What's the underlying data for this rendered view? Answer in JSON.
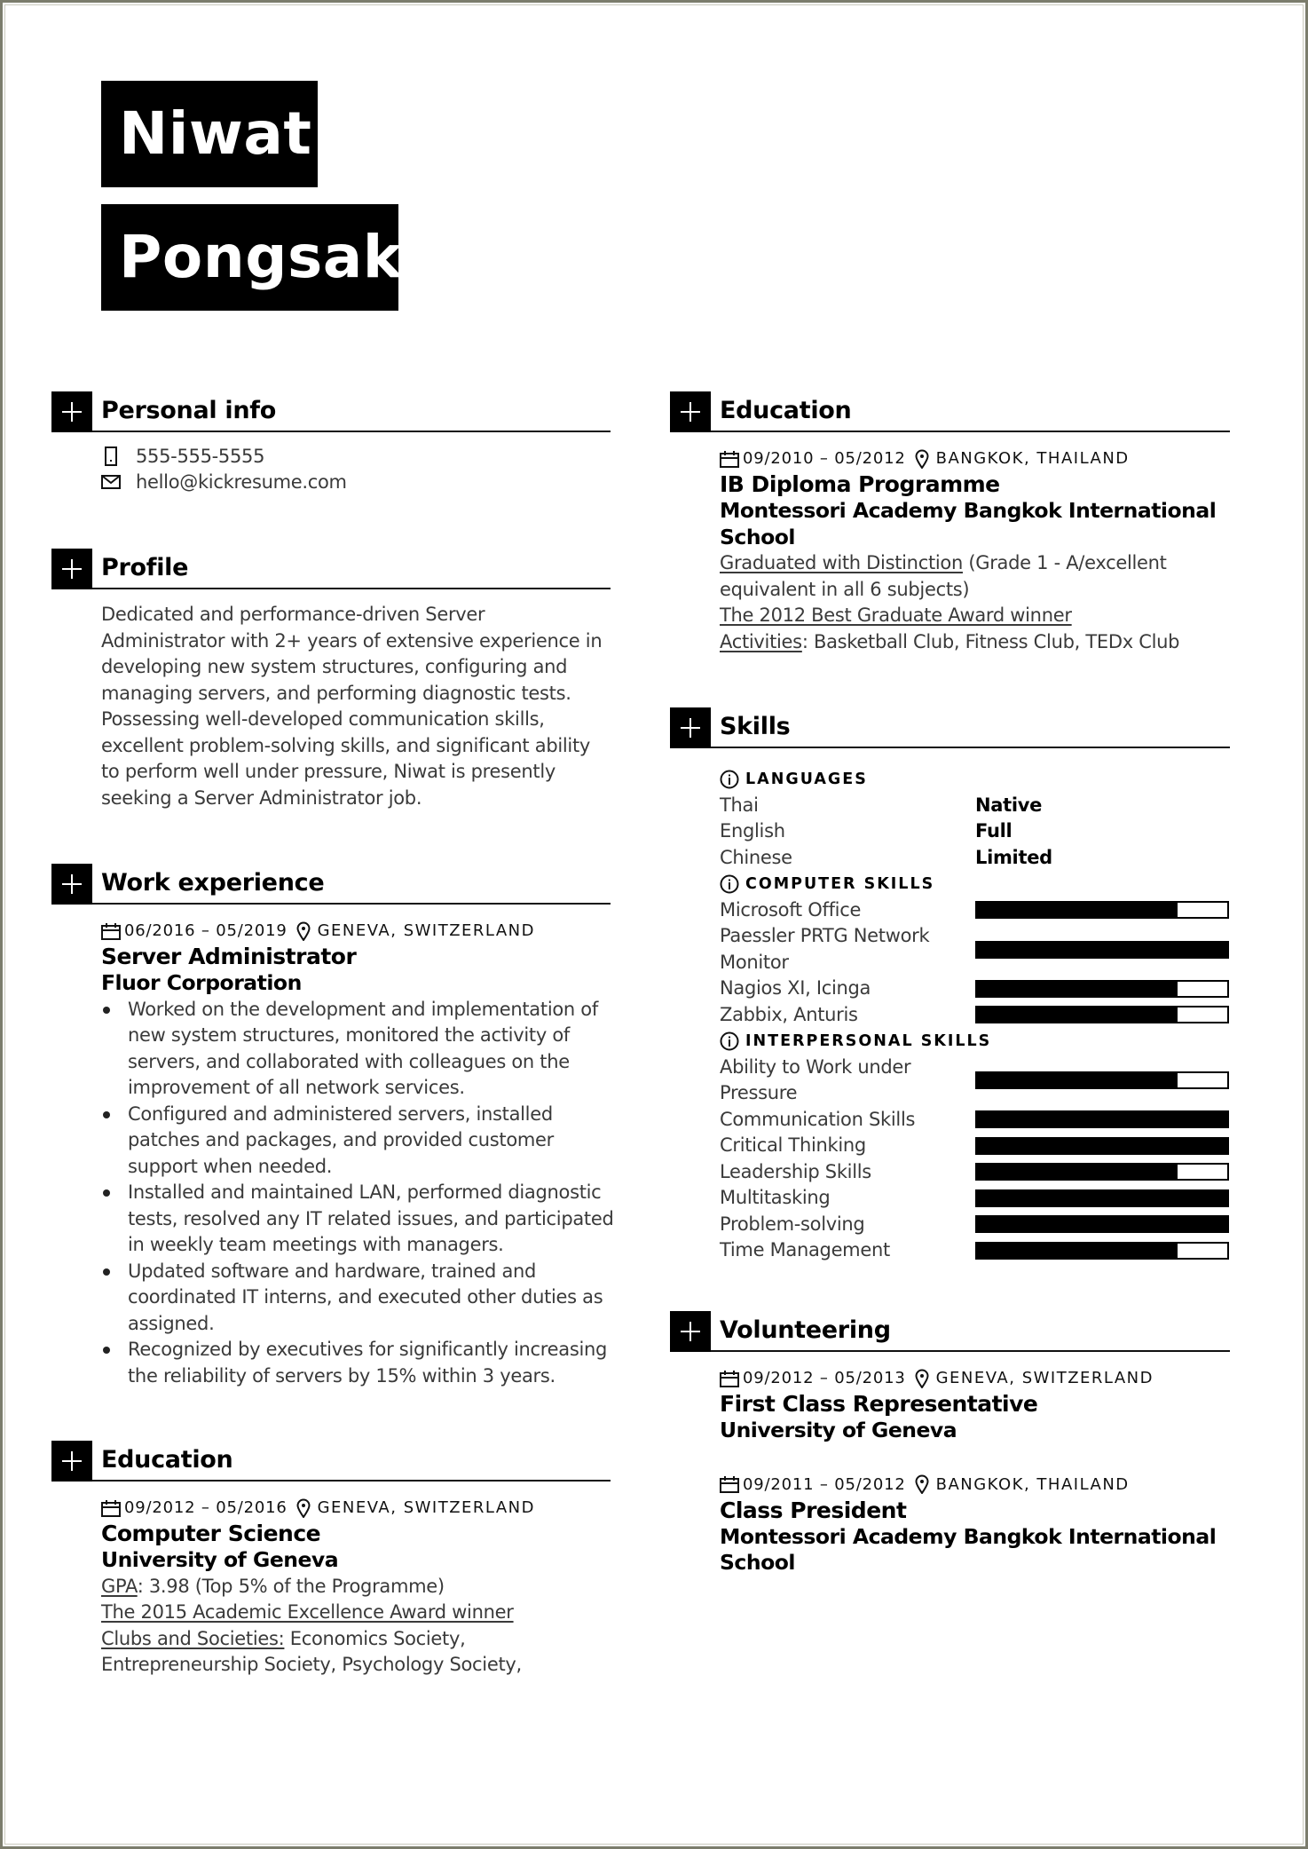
{
  "name": {
    "first": "Niwat",
    "last": "Pongsak"
  },
  "personal_info": {
    "title": "Personal info",
    "phone": "555-555-5555",
    "email": "hello@kickresume.com"
  },
  "profile": {
    "title": "Profile",
    "lines": [
      "Dedicated and performance-driven Server",
      "Administrator with 2+ years of extensive experience in",
      "developing new system structures, configuring and",
      "managing servers, and performing diagnostic tests.",
      "Possessing well-developed communication skills,",
      "excellent problem-solving skills, and significant ability",
      "to perform well under pressure, Niwat is presently",
      "seeking a Server Administrator job."
    ]
  },
  "work_experience": {
    "title": "Work experience",
    "entries": [
      {
        "dates": "06/2016 – 05/2019",
        "location": "GENEVA, SWITZERLAND",
        "role": "Server Administrator",
        "company": "Fluor Corporation",
        "bullets": [
          "Worked on the development and implementation of new system structures, monitored the activity of servers, and collaborated with colleagues on the improvement of all network services.",
          "Configured and administered servers, installed patches and packages, and provided customer support when needed.",
          "Installed and maintained LAN, performed diagnostic tests, resolved any IT related issues, and participated in weekly team meetings with managers.",
          "Updated software and hardware, trained and coordinated IT interns, and executed other duties as assigned.",
          "Recognized by executives for significantly increasing the reliability of servers by 15% within 3 years."
        ]
      }
    ]
  },
  "education_left": {
    "title": "Education",
    "dates": "09/2012 – 05/2016",
    "location": "GENEVA, SWITZERLAND",
    "degree": "Computer Science",
    "school": "University of Geneva",
    "gpa_label": "GPA",
    "gpa_value": ": 3.98 (Top 5% of the Programme)",
    "award": "The 2015 Academic Excellence Award winner",
    "clubs_label": "Clubs and Societies:",
    "clubs_value": " Economics Society,",
    "clubs_line2": "Entrepreneurship Society, Psychology Society,"
  },
  "education_right": {
    "title": "Education",
    "dates": "09/2010 – 05/2012",
    "location": "BANGKOK, THAILAND",
    "degree": "IB Diploma Programme",
    "school_line1": "Montessori Academy Bangkok International",
    "school_line2": "School",
    "distinction_label": "Graduated with Distinction",
    "distinction_value": " (Grade 1 - A/excellent",
    "distinction_line2": "equivalent in all 6 subjects)",
    "award": "The 2012 Best Graduate Award winner",
    "activities_label": "Activities",
    "activities_value": ": Basketball Club, Fitness Club, TEDx Club"
  },
  "skills": {
    "title": "Skills",
    "languages": {
      "label": "LANGUAGES",
      "items": [
        {
          "name": "Thai",
          "level": "Native"
        },
        {
          "name": "English",
          "level": "Full"
        },
        {
          "name": "Chinese",
          "level": "Limited"
        }
      ]
    },
    "computer": {
      "label": "COMPUTER SKILLS",
      "items": [
        {
          "name": "Microsoft Office",
          "name2": "",
          "level": 0.8
        },
        {
          "name": "Paessler PRTG Network",
          "name2": "Monitor",
          "level": 1.0
        },
        {
          "name": "Nagios XI, Icinga",
          "name2": "",
          "level": 0.8
        },
        {
          "name": "Zabbix, Anturis",
          "name2": "",
          "level": 0.8
        }
      ]
    },
    "interpersonal": {
      "label": "INTERPERSONAL SKILLS",
      "items": [
        {
          "name": "Ability to Work under",
          "name2": "Pressure",
          "level": 0.8
        },
        {
          "name": "Communication Skills",
          "name2": "",
          "level": 1.0
        },
        {
          "name": "Critical Thinking",
          "name2": "",
          "level": 1.0
        },
        {
          "name": "Leadership Skills",
          "name2": "",
          "level": 0.8
        },
        {
          "name": "Multitasking",
          "name2": "",
          "level": 1.0
        },
        {
          "name": "Problem-solving",
          "name2": "",
          "level": 1.0
        },
        {
          "name": "Time Management",
          "name2": "",
          "level": 0.8
        }
      ]
    }
  },
  "volunteering": {
    "title": "Volunteering",
    "entries": [
      {
        "dates": "09/2012 – 05/2013",
        "location": "GENEVA, SWITZERLAND",
        "role": "First Class Representative",
        "org_line1": "University of Geneva",
        "org_line2": ""
      },
      {
        "dates": "09/2011 – 05/2012",
        "location": "BANGKOK, THAILAND",
        "role": "Class President",
        "org_line1": "Montessori Academy Bangkok International",
        "org_line2": "School"
      }
    ]
  }
}
